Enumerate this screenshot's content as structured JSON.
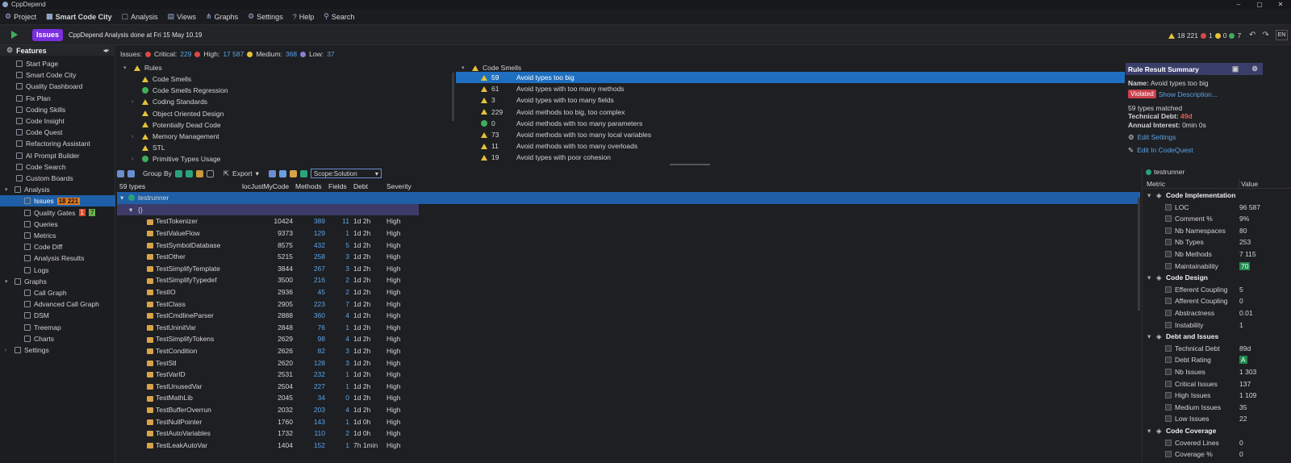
{
  "window": {
    "title": "CppDepend"
  },
  "menu": [
    {
      "label": "Project",
      "icon": "project-icon"
    },
    {
      "label": "Smart Code City",
      "icon": "city-icon"
    },
    {
      "label": "Analysis",
      "icon": "analysis-icon"
    },
    {
      "label": "Views",
      "icon": "views-icon"
    },
    {
      "label": "Graphs",
      "icon": "graphs-icon"
    },
    {
      "label": "Settings",
      "icon": "gear-icon"
    },
    {
      "label": "Help",
      "icon": "help-icon"
    },
    {
      "label": "Search",
      "icon": "search-icon"
    }
  ],
  "status": {
    "issues_label": "Issues",
    "message": "CppDepend Analysis done at Fri 15 May  10.19",
    "warn_count": "18 221",
    "red_count": "1",
    "yellow_count": "0",
    "green_count": "7",
    "lang": "EN"
  },
  "sidebar": {
    "title": "Features",
    "items": [
      "Start Page",
      "Smart Code City",
      "Quality Dashboard",
      "Fix Plan",
      "Coding Skills",
      "Code Insight",
      "Code Quest",
      "Refactoring Assistant",
      "AI Prompt Builder",
      "Code Search",
      "Custom Boards"
    ],
    "analysis": {
      "label": "Analysis",
      "issues": "Issues",
      "issues_badge": "18 221",
      "gates": "Quality Gates",
      "gates_fail": "1",
      "gates_pass": "7",
      "queries": "Queries",
      "metrics": "Metrics",
      "codediff": "Code Diff",
      "results": "Analysis Results",
      "logs": "Logs"
    },
    "graphs": {
      "label": "Graphs",
      "items": [
        "Call Graph",
        "Advanced Call Graph",
        "DSM",
        "Treemap",
        "Charts"
      ]
    },
    "settings": "Settings"
  },
  "issues_summary": {
    "label": "Issues:",
    "critical_label": "Critical:",
    "critical": "229",
    "high_label": "High:",
    "high": "17 587",
    "medium_label": "Medium:",
    "medium": "368",
    "low_label": "Low:",
    "low": "37"
  },
  "rules": {
    "root": "Rules",
    "items": [
      {
        "label": "Code Smells",
        "status": "warn",
        "expand": false
      },
      {
        "label": "Code Smells Regression",
        "status": "ok",
        "expand": false
      },
      {
        "label": "Coding Standards",
        "status": "warn",
        "expand": true
      },
      {
        "label": "Object Oriented Design",
        "status": "warn",
        "expand": false
      },
      {
        "label": "Potentially Dead Code",
        "status": "warn",
        "expand": false
      },
      {
        "label": "Memory Management",
        "status": "warn",
        "expand": true
      },
      {
        "label": "STL",
        "status": "warn",
        "expand": false
      },
      {
        "label": "Primitive Types Usage",
        "status": "ok",
        "expand": true
      }
    ]
  },
  "smells": {
    "root": "Code Smells",
    "items": [
      {
        "count": "59",
        "label": "Avoid types too big",
        "status": "warn"
      },
      {
        "count": "61",
        "label": "Avoid types with too many methods",
        "status": "warn"
      },
      {
        "count": "3",
        "label": "Avoid types with too many fields",
        "status": "warn"
      },
      {
        "count": "229",
        "label": "Avoid methods too big, too complex",
        "status": "warn"
      },
      {
        "count": "0",
        "label": "Avoid methods with too many parameters",
        "status": "ok"
      },
      {
        "count": "73",
        "label": "Avoid methods with too many local variables",
        "status": "warn"
      },
      {
        "count": "11",
        "label": "Avoid methods with too many overloads",
        "status": "warn"
      },
      {
        "count": "19",
        "label": "Avoid types with poor cohesion",
        "status": "warn"
      }
    ]
  },
  "rule_summary": {
    "title": "Rule Result Summary",
    "name_label": "Name:",
    "name": "Avoid types too big",
    "violated": "Violated",
    "show_desc": "Show Description...",
    "matched": "59 types  matched",
    "debt_label": "Technical Debt:",
    "debt": "49d",
    "interest_label": "Annual Interest:",
    "interest": "0min  0s",
    "edit_settings": "Edit Settings",
    "edit_quest": "Edit In CodeQuest"
  },
  "toolbar": {
    "group_by": "Group By",
    "export": "Export",
    "scope": "Scope:Solution"
  },
  "grid": {
    "columns": [
      "59 types",
      "locJustMyCode",
      "Methods",
      "Fields",
      "Debt",
      "Severity"
    ],
    "root": "testrunner",
    "ns": "{}",
    "rows": [
      [
        "TestTokenizer",
        "10424",
        "389",
        "11",
        "1d  2h",
        "High"
      ],
      [
        "TestValueFlow",
        "9373",
        "129",
        "1",
        "1d  2h",
        "High"
      ],
      [
        "TestSymbolDatabase",
        "8575",
        "432",
        "5",
        "1d  2h",
        "High"
      ],
      [
        "TestOther",
        "5215",
        "258",
        "3",
        "1d  2h",
        "High"
      ],
      [
        "TestSimplifyTemplate",
        "3844",
        "267",
        "3",
        "1d  2h",
        "High"
      ],
      [
        "TestSimplifyTypedef",
        "3500",
        "216",
        "2",
        "1d  2h",
        "High"
      ],
      [
        "TestIO",
        "2936",
        "45",
        "2",
        "1d  2h",
        "High"
      ],
      [
        "TestClass",
        "2905",
        "223",
        "7",
        "1d  2h",
        "High"
      ],
      [
        "TestCmdlineParser",
        "2888",
        "360",
        "4",
        "1d  2h",
        "High"
      ],
      [
        "TestUninitVar",
        "2848",
        "76",
        "1",
        "1d  2h",
        "High"
      ],
      [
        "TestSimplifyTokens",
        "2629",
        "98",
        "4",
        "1d  2h",
        "High"
      ],
      [
        "TestCondition",
        "2626",
        "82",
        "3",
        "1d  2h",
        "High"
      ],
      [
        "TestStl",
        "2620",
        "128",
        "3",
        "1d  2h",
        "High"
      ],
      [
        "TestVarID",
        "2531",
        "232",
        "1",
        "1d  2h",
        "High"
      ],
      [
        "TestUnusedVar",
        "2504",
        "227",
        "1",
        "1d  2h",
        "High"
      ],
      [
        "TestMathLib",
        "2045",
        "34",
        "0",
        "1d  2h",
        "High"
      ],
      [
        "TestBufferOverrun",
        "2032",
        "203",
        "4",
        "1d  2h",
        "High"
      ],
      [
        "TestNullPointer",
        "1760",
        "143",
        "1",
        "1d  0h",
        "High"
      ],
      [
        "TestAutoVariables",
        "1732",
        "110",
        "2",
        "1d  0h",
        "High"
      ],
      [
        "TestLeakAutoVar",
        "1404",
        "152",
        "1",
        "7h  1min",
        "High"
      ]
    ]
  },
  "metrics": {
    "title": "testrunner",
    "col_metric": "Metric",
    "col_value": "Value",
    "rows": [
      {
        "type": "head",
        "label": "Code Implementation"
      },
      {
        "label": "LOC",
        "value": "96 587"
      },
      {
        "label": "Comment %",
        "value": "9%"
      },
      {
        "label": "Nb Namespaces",
        "value": "80"
      },
      {
        "label": "Nb Types",
        "value": "253"
      },
      {
        "label": "Nb Methods",
        "value": "7 115"
      },
      {
        "label": "Maintainability",
        "value": "70",
        "hl": true
      },
      {
        "type": "head",
        "label": "Code Design"
      },
      {
        "label": "Efferent Coupling",
        "value": "5"
      },
      {
        "label": "Afferent Coupling",
        "value": "0"
      },
      {
        "label": "Abstractness",
        "value": "0.01"
      },
      {
        "label": "Instability",
        "value": "1"
      },
      {
        "type": "head",
        "label": "Debt and Issues"
      },
      {
        "label": "Technical Debt",
        "value": "89d"
      },
      {
        "label": "Debt Rating",
        "value": "A",
        "hl": true
      },
      {
        "label": "Nb Issues",
        "value": "1 303"
      },
      {
        "label": "Critical Issues",
        "value": "137"
      },
      {
        "label": "High Issues",
        "value": "1 109"
      },
      {
        "label": "Medium Issues",
        "value": "35"
      },
      {
        "label": "Low Issues",
        "value": "22"
      },
      {
        "type": "head",
        "label": "Code Coverage"
      },
      {
        "label": "Covered Lines",
        "value": "0"
      },
      {
        "label": "Coverage %",
        "value": "0"
      }
    ]
  }
}
